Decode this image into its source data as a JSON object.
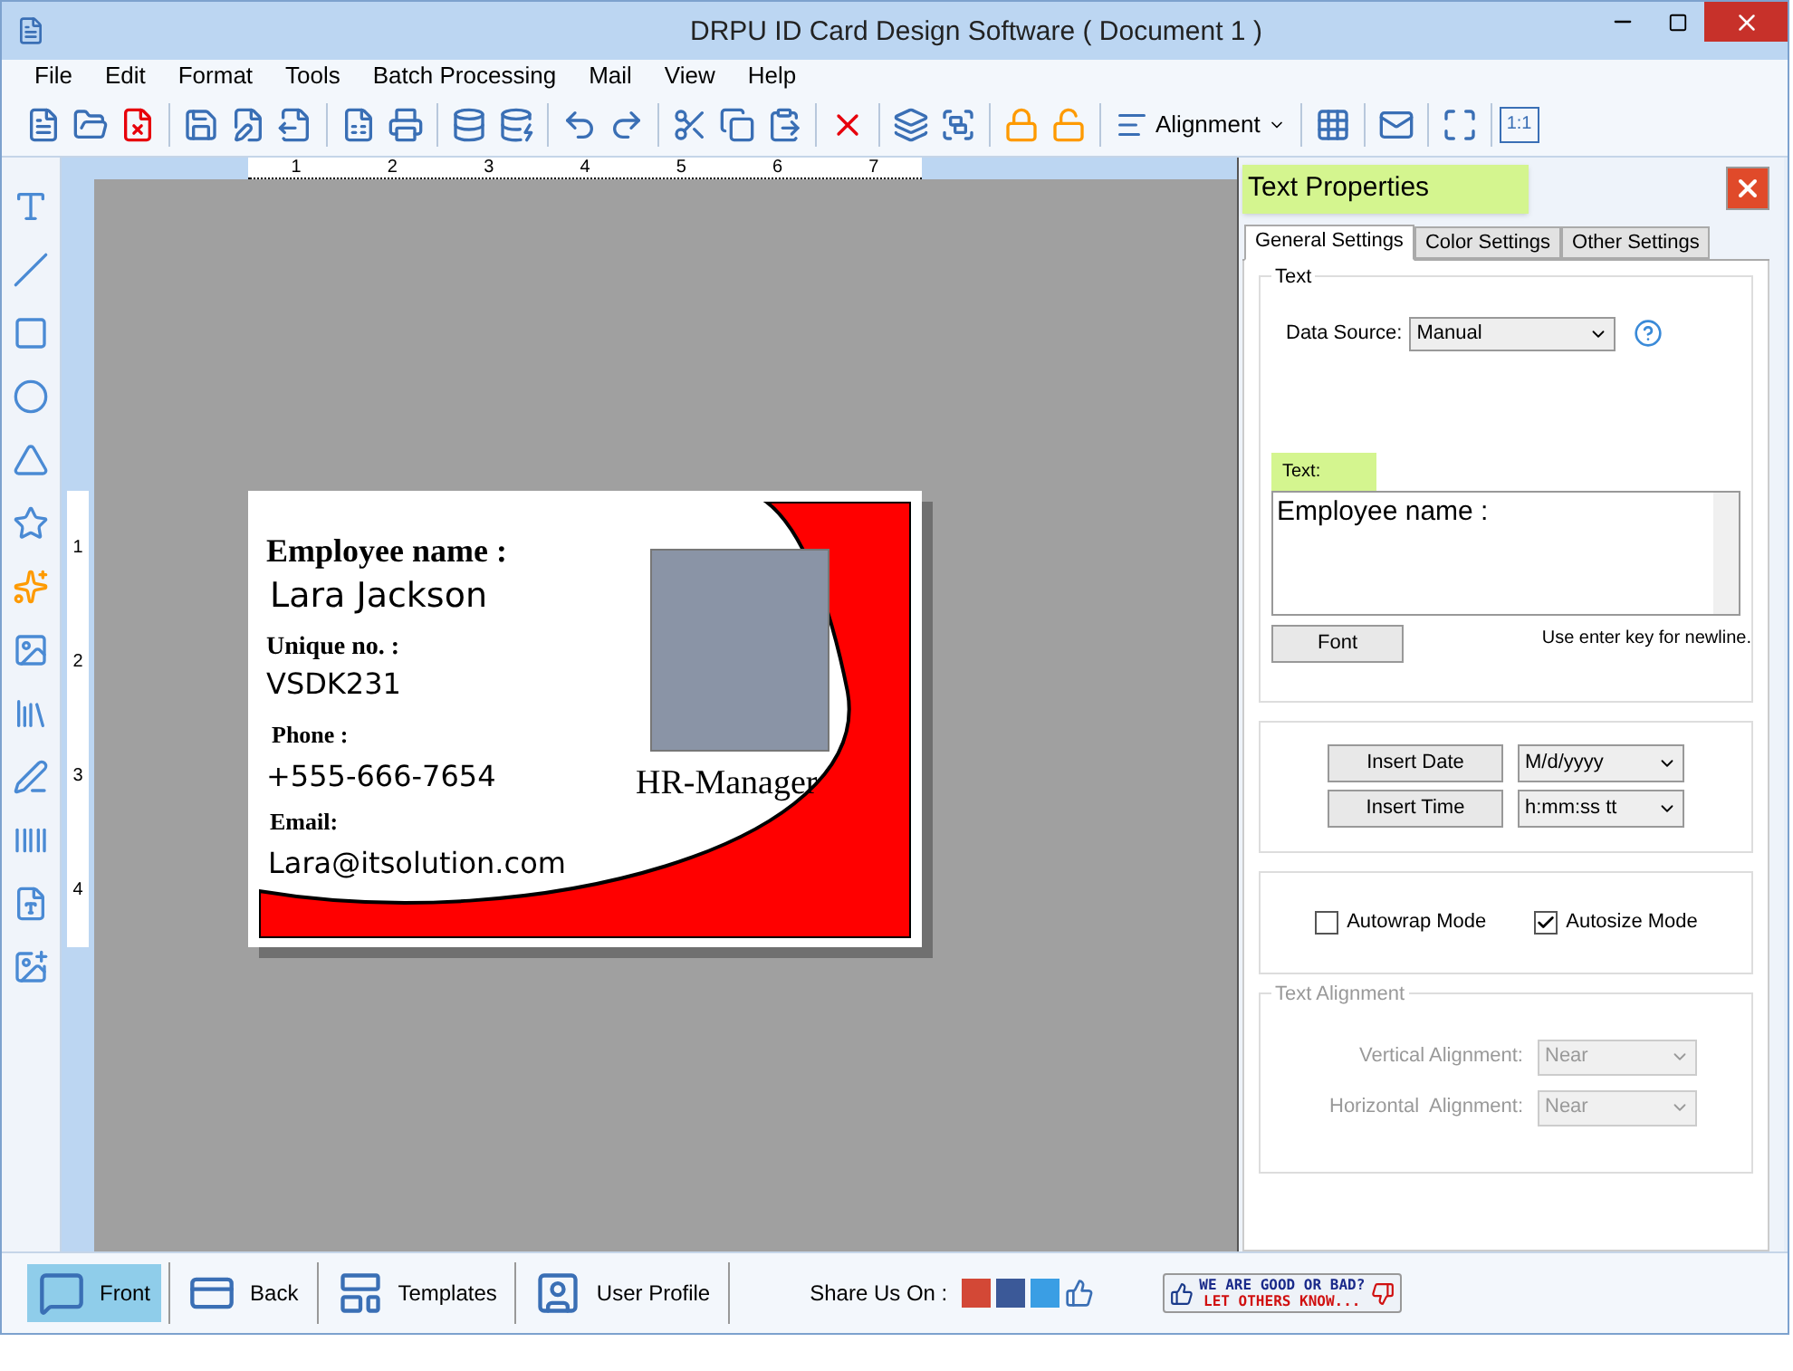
{
  "window": {
    "title": "DRPU ID Card Design Software ( Document 1 )"
  },
  "menu": [
    "File",
    "Edit",
    "Format",
    "Tools",
    "Batch Processing",
    "Mail",
    "View",
    "Help"
  ],
  "toolbar": {
    "alignment_label": "Alignment",
    "zoom_label": "1:1"
  },
  "ruler": {
    "horizontal": [
      "1",
      "2",
      "3",
      "4",
      "5",
      "6",
      "7"
    ],
    "vertical": [
      "1",
      "2",
      "3",
      "4"
    ]
  },
  "card": {
    "name_label": "Employee name :",
    "name": "Lara Jackson",
    "id_label": "Unique no. :",
    "id": "VSDK231",
    "phone_label": "Phone :",
    "phone": "+555-666-7654",
    "email_label": "Email:",
    "email": "Lara@itsolution.com",
    "designation": "HR-Manager"
  },
  "panel": {
    "title": "Text Properties",
    "tabs": [
      {
        "label": "General Settings",
        "selected": true
      },
      {
        "label": "Color Settings",
        "selected": false
      },
      {
        "label": "Other Settings",
        "selected": false
      }
    ],
    "group_title": "Text",
    "data_source_label": "Data Source:",
    "data_source": "Manual",
    "text_label": "Text:",
    "text_value": "Employee name :",
    "font_button": "Font",
    "hint": "Use enter key for newline.",
    "insert": [
      {
        "button": "Insert Date",
        "format": "M/d/yyyy"
      },
      {
        "button": "Insert Time",
        "format": "h:mm:ss tt"
      }
    ],
    "modes": [
      {
        "label": "Autowrap Mode",
        "checked": false
      },
      {
        "label": "Autosize Mode",
        "checked": true
      }
    ],
    "alignment": {
      "title": "Text Alignment",
      "disabled": true,
      "rows": [
        {
          "label": "Vertical Alignment:",
          "value": "Near"
        },
        {
          "label": "Horizontal  Alignment:",
          "value": "Near"
        }
      ]
    }
  },
  "bottom_bar": {
    "views": [
      {
        "label": "Front",
        "selected": true
      },
      {
        "label": "Back",
        "selected": false
      },
      {
        "label": "Templates",
        "selected": false
      },
      {
        "label": "User Profile",
        "selected": false
      }
    ],
    "share_label": "Share Us On :",
    "rating_line_1": "WE ARE GOOD OR BAD?",
    "rating_line_2": "LET OTHERS KNOW..."
  }
}
